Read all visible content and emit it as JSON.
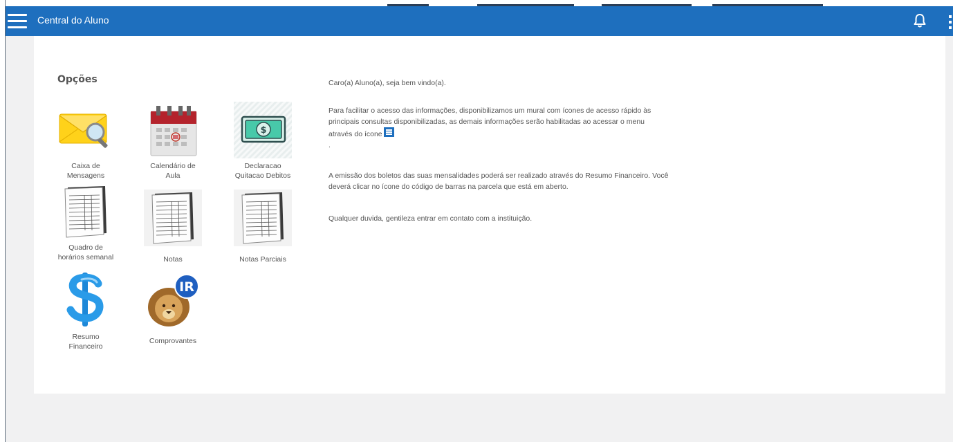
{
  "app": {
    "title": "Central do Aluno"
  },
  "colors": {
    "appbar": "#1e6fbe",
    "accent": "#1e6fbe"
  },
  "header": {
    "menu_icon": "hamburger-menu-icon",
    "notifications_icon": "bell-icon",
    "more_icon": "more-vertical-icon"
  },
  "options": {
    "title": "Opções",
    "tiles": [
      {
        "label": "Caixa de Mensagens",
        "icon": "envelope-search-icon"
      },
      {
        "label": "Calendário de Aula",
        "icon": "calendar-icon"
      },
      {
        "label": "Declaracao Quitacao Debitos",
        "icon": "money-bill-icon"
      },
      {
        "label": "Quadro de horários semanal",
        "icon": "timetable-document-icon"
      },
      {
        "label": "Notas",
        "icon": "grades-document-icon"
      },
      {
        "label": "Notas Parciais",
        "icon": "partial-grades-document-icon"
      },
      {
        "label": "Resumo Financeiro",
        "icon": "dollar-sign-icon"
      },
      {
        "label": "Comprovantes",
        "icon": "lion-ir-icon"
      }
    ]
  },
  "info": {
    "greeting": "Caro(a) Aluno(a), seja bem vindo(a).",
    "intro": "Para facilitar o acesso das informações, disponibilizamos um mural com ícones de acesso rápido às principais consultas disponibilizadas, as demais informações serão habilitadas ao acessar o menu através do ícone",
    "dot": ".",
    "boletos": "A emissão dos boletos das suas mensalidades poderá ser realizado através do Resumo Financeiro. Você deverá clicar no ícone do código de barras na parcela que está em aberto.",
    "contato": "Qualquer duvida, gentileza entrar em contato com a instituição."
  }
}
